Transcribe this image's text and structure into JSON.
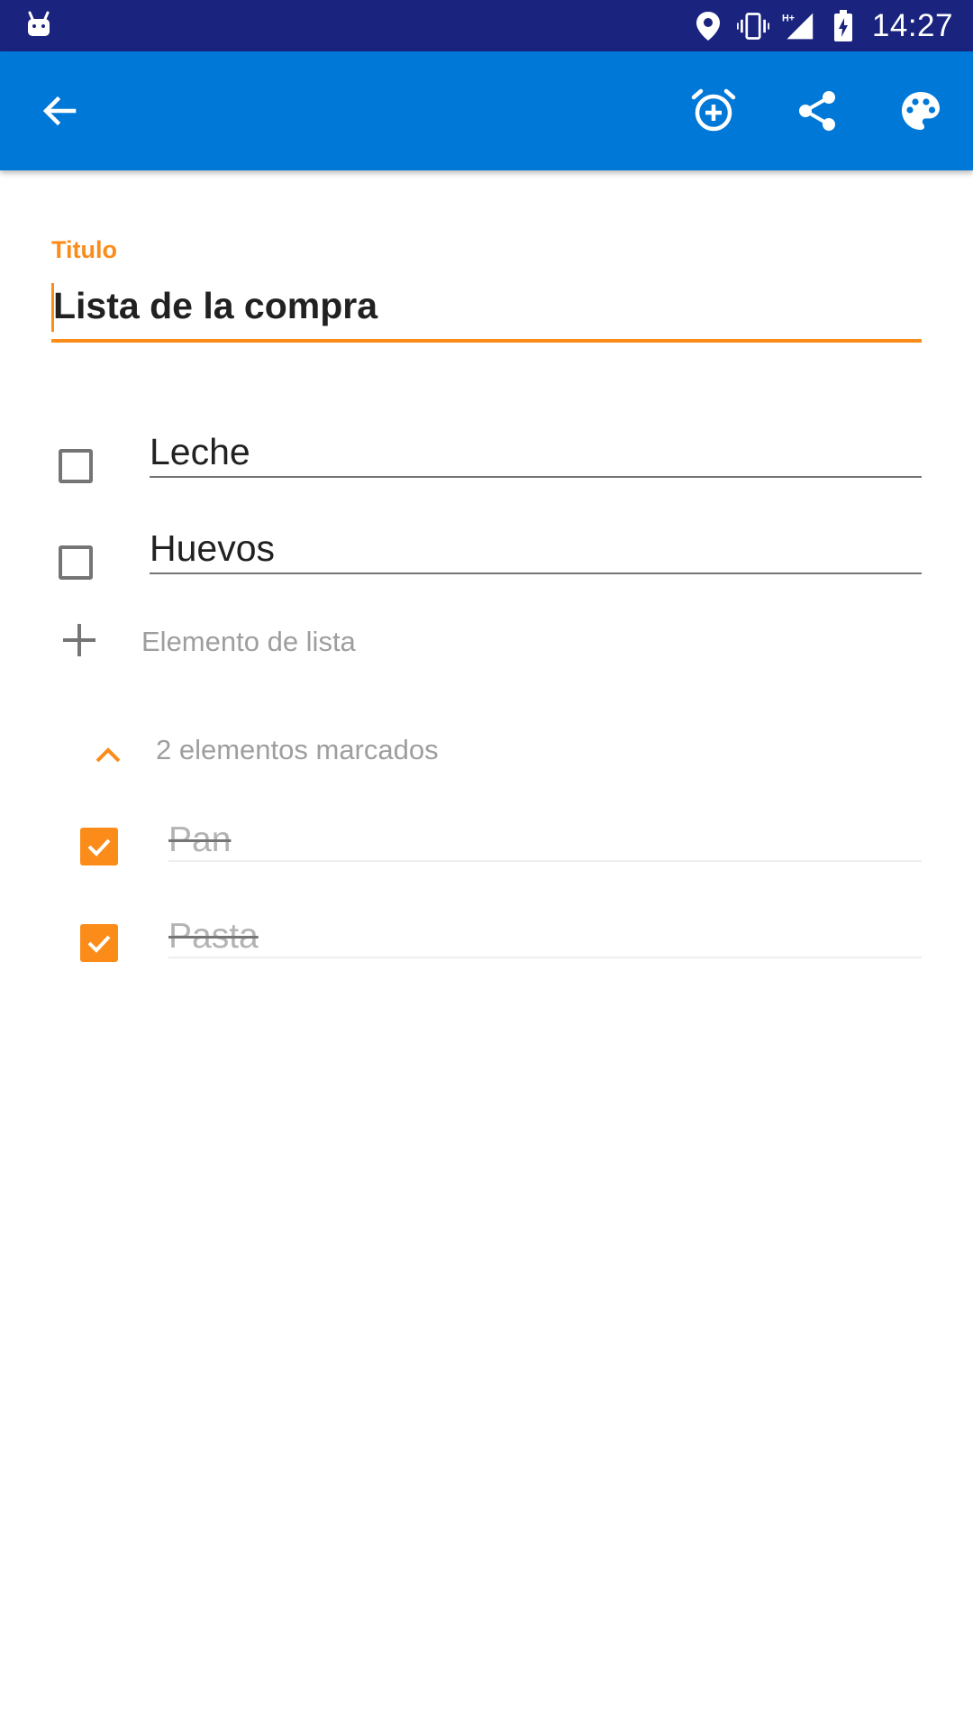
{
  "status_bar": {
    "time": "14:27",
    "icons": [
      "android-notification-icon",
      "location-icon",
      "vibrate-icon",
      "network-h-plus-icon",
      "signal-icon",
      "battery-charging-icon"
    ]
  },
  "app_bar": {
    "color": "#0078d7",
    "actions": [
      "back-arrow-icon",
      "add-alarm-icon",
      "share-icon",
      "palette-icon"
    ]
  },
  "title_field": {
    "label": "Titulo",
    "value": "Lista de la compra",
    "accent": "#fb8c1a"
  },
  "items": [
    {
      "text": "Leche",
      "checked": false
    },
    {
      "text": "Huevos",
      "checked": false
    }
  ],
  "add_item": {
    "placeholder": "Elemento de lista"
  },
  "checked_section": {
    "summary": "2 elementos marcados",
    "items": [
      {
        "text": "Pan",
        "checked": true
      },
      {
        "text": "Pasta",
        "checked": true
      }
    ]
  }
}
